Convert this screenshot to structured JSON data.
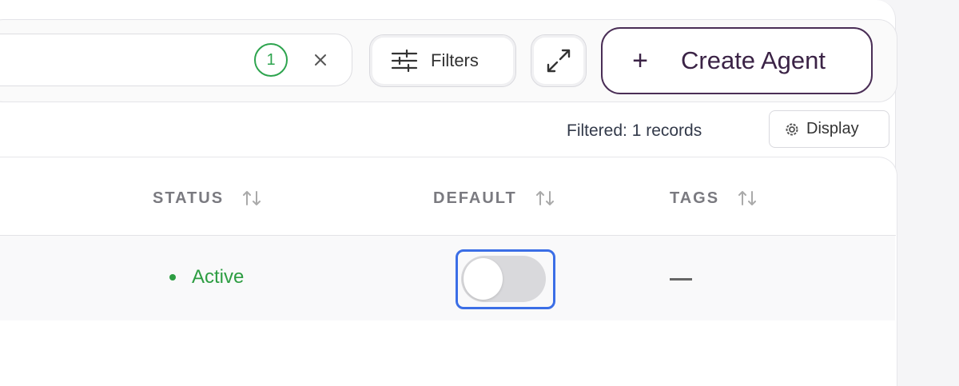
{
  "toolbar": {
    "search_match_count": "1",
    "filters_label": "Filters",
    "create_label": "Create Agent",
    "create_plus": "+"
  },
  "summary": {
    "filtered_text": "Filtered: 1 records",
    "display_label": "Display"
  },
  "table": {
    "columns": [
      {
        "label": "STATUS"
      },
      {
        "label": "DEFAULT"
      },
      {
        "label": "TAGS"
      }
    ],
    "rows": [
      {
        "status": "Active",
        "default_enabled": false,
        "tags": ""
      }
    ]
  },
  "icons": {
    "clear": "close-icon",
    "filters": "sliders-icon",
    "expand": "expand-icon",
    "display": "gear-icon",
    "sort": "sort-icon"
  },
  "colors": {
    "status_active": "#2d9d42",
    "badge": "#2da44e",
    "create_border": "#4a2e56",
    "focus_ring": "#3b6ee6"
  }
}
